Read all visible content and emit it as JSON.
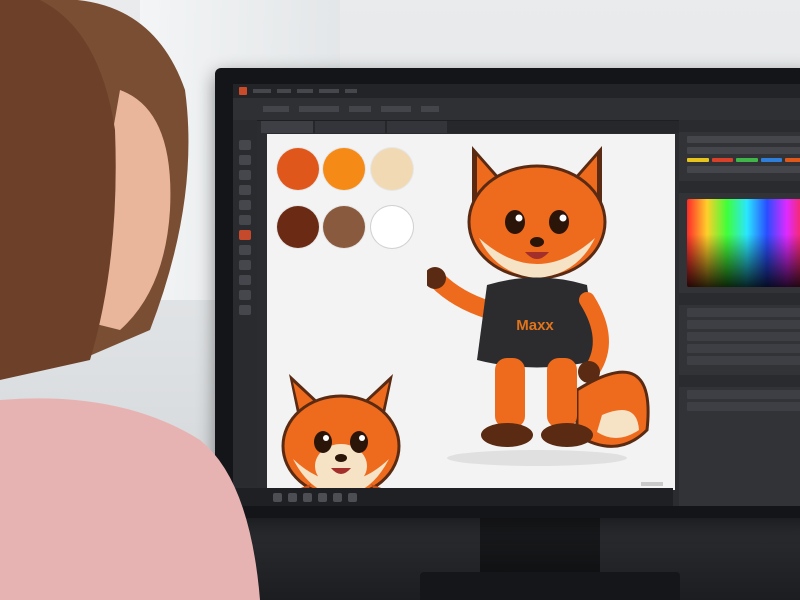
{
  "mascot": {
    "shirt_text": "Maxx"
  },
  "palette": {
    "colors": [
      "#e0571c",
      "#f58a17",
      "#f1d9b4",
      "#6a2a14",
      "#8a5a3e",
      "#ffffff"
    ]
  },
  "colors": {
    "fox_orange": "#ee6a1d",
    "fox_cream": "#f6e2c4",
    "fox_dark": "#5a2a12",
    "shirt": "#2c2c2e"
  },
  "icons": [
    "color-picker-icon",
    "tool-icons",
    "layers-icon"
  ]
}
